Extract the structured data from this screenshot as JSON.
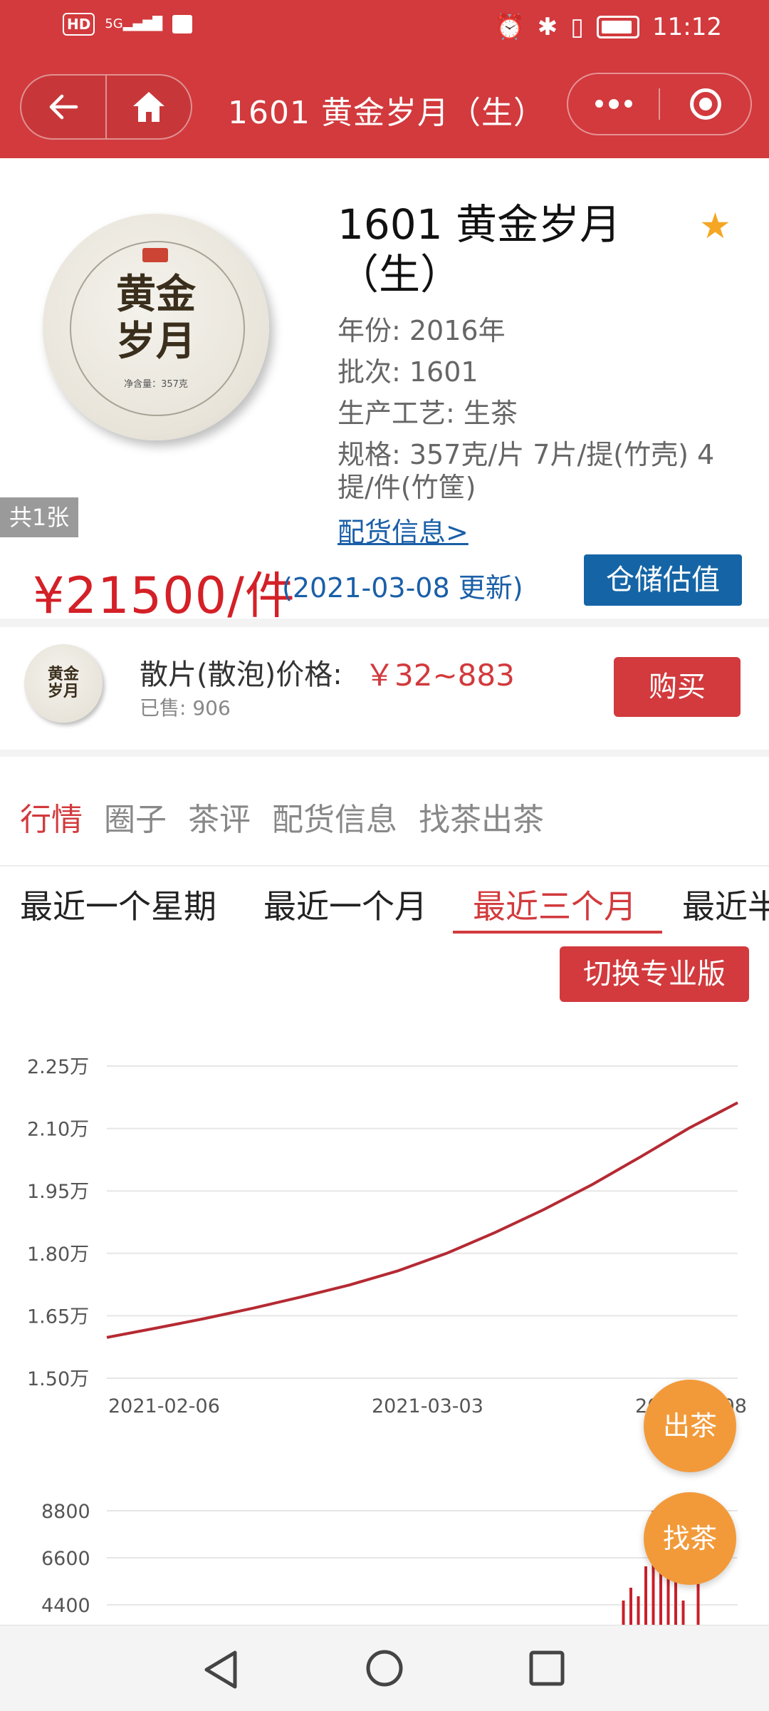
{
  "status_bar": {
    "time": "11:12",
    "hd": "HD",
    "network": "5G"
  },
  "header": {
    "title": "1601 黄金岁月（生）"
  },
  "product": {
    "title_line1": "1601 黄金岁月",
    "title_line2": "（生）",
    "cake_text_line1": "黄金",
    "cake_text_line2": "岁月",
    "cake_net_weight": "净含量：357克",
    "image_count": "共1张",
    "attributes": [
      "年份: 2016年",
      "批次: 1601",
      "生产工艺: 生茶",
      "规格: 357克/片 7片/提(竹壳) 4",
      "提/件(竹筐)"
    ],
    "shipping_link": "配货信息>",
    "price": "¥21500/件",
    "updated": "(2021-03-08 更新)",
    "storage_button": "仓储估值"
  },
  "loose": {
    "cake_text_line1": "黄金",
    "cake_text_line2": "岁月",
    "label": "散片(散泡)价格:",
    "price": "￥32~883",
    "sold": "已售: 906",
    "buy_button": "购买"
  },
  "tabs": [
    "行情",
    "圈子",
    "茶评",
    "配货信息",
    "找茶出茶"
  ],
  "active_tab": 0,
  "period_tabs": [
    "最近一个星期",
    "最近一个月",
    "最近三个月",
    "最近半"
  ],
  "active_period": 2,
  "pro_button": "切换专业版",
  "chart_data": [
    {
      "type": "line",
      "x": [
        "2021-02-06",
        "2021-03-03",
        "2021-03-08"
      ],
      "x_tick_labels": [
        "2021-02-06",
        "2021-03-03",
        "2021-03-08"
      ],
      "y_tick_labels": [
        "2.25万",
        "2.10万",
        "1.95万",
        "1.80万",
        "1.65万",
        "1.50万"
      ],
      "ylim": [
        15000,
        22500
      ],
      "series": [
        {
          "color": "#b52a33",
          "points": [
            [
              0,
              15980
            ],
            [
              0.1,
              16200
            ],
            [
              0.2,
              16430
            ],
            [
              0.3,
              16680
            ],
            [
              0.4,
              16950
            ],
            [
              0.5,
              17240
            ],
            [
              0.6,
              17580
            ],
            [
              0.7,
              18000
            ],
            [
              0.8,
              18500
            ],
            [
              0.9,
              19050
            ],
            [
              1.0,
              19650
            ],
            [
              1.1,
              20320
            ],
            [
              1.2,
              21010
            ],
            [
              1.3,
              21620
            ]
          ]
        }
      ],
      "grid": true
    },
    {
      "type": "bar",
      "y_tick_labels": [
        "8800",
        "6600",
        "4400"
      ],
      "ylim": [
        2200,
        8800
      ],
      "values_note": "partially visible volume bars near right end",
      "values": [
        2400,
        2600,
        3200,
        4600,
        5200,
        4800,
        6200,
        8800,
        7000,
        6200,
        5800,
        4600,
        3400,
        6800,
        2600
      ],
      "grid": true
    }
  ],
  "fabs": {
    "sell": "出茶",
    "find": "找茶"
  }
}
